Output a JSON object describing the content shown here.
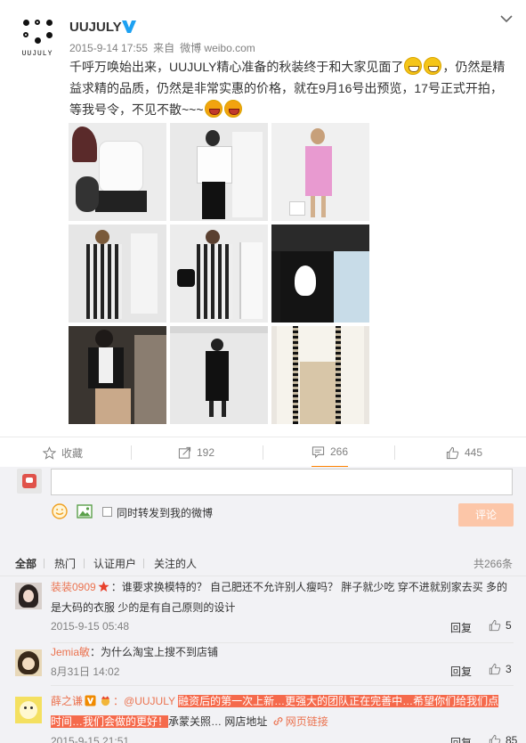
{
  "post": {
    "author": "UUJULY",
    "logo_text": "UUJULY",
    "timestamp": "2015-9-14 17:55",
    "source_prefix": "来自",
    "source": "微博 weibo.com",
    "text_line1": "千呼万唤始出来，UUJULY精心准备的秋装终于和大家见面了",
    "text_line1_tail": "，仍然是精",
    "text_line2": "益求精的品质，仍然是非常实惠的价格，就在9月16号出预览，17号正式开拍，",
    "text_line3": "等我号令，不见不散~~~"
  },
  "actions": {
    "favorite_label": "收藏",
    "repost_count": "192",
    "comment_count": "266",
    "like_count": "445"
  },
  "composer": {
    "repost_checkbox_label": "同时转发到我的微博",
    "submit_label": "评论"
  },
  "filters": {
    "tabs": [
      "全部",
      "热门",
      "认证用户",
      "关注的人"
    ],
    "total": "共266条"
  },
  "comments": [
    {
      "user": "装装0909",
      "text_line1": "：谁要求换模特的？ 自己肥还不允许别人瘦吗？ 胖子就少吃 穿不进就别家去买 多的",
      "text_line2": "是大码的衣服 少的是有自己原则的设计",
      "date": "2015-9-15 05:48",
      "reply": "回复",
      "likes": "5"
    },
    {
      "user": "Jemia敏",
      "text_line1": "：为什么淘宝上搜不到店铺",
      "date": "8月31日 14:02",
      "reply": "回复",
      "likes": "3"
    },
    {
      "user": "薛之谦",
      "mention": "：@UUJULY",
      "highlight1": "融资后的第一次上新…更强大的团队正在完善中…希望你们给我们点",
      "highlight2": "时间…我们会做的更好！",
      "tail": "承蒙关照… 网店地址",
      "link": "网页链接",
      "date": "2015-9-15 21:51",
      "reply": "回复",
      "likes": "85"
    }
  ],
  "colors": {
    "accent": "#ff8200",
    "username": "#eb7350",
    "verified": "#1da1f2",
    "highlight": "#f56a4c",
    "submit_disabled": "#fcc6a8",
    "comment_bg": "#f2f2f5"
  }
}
